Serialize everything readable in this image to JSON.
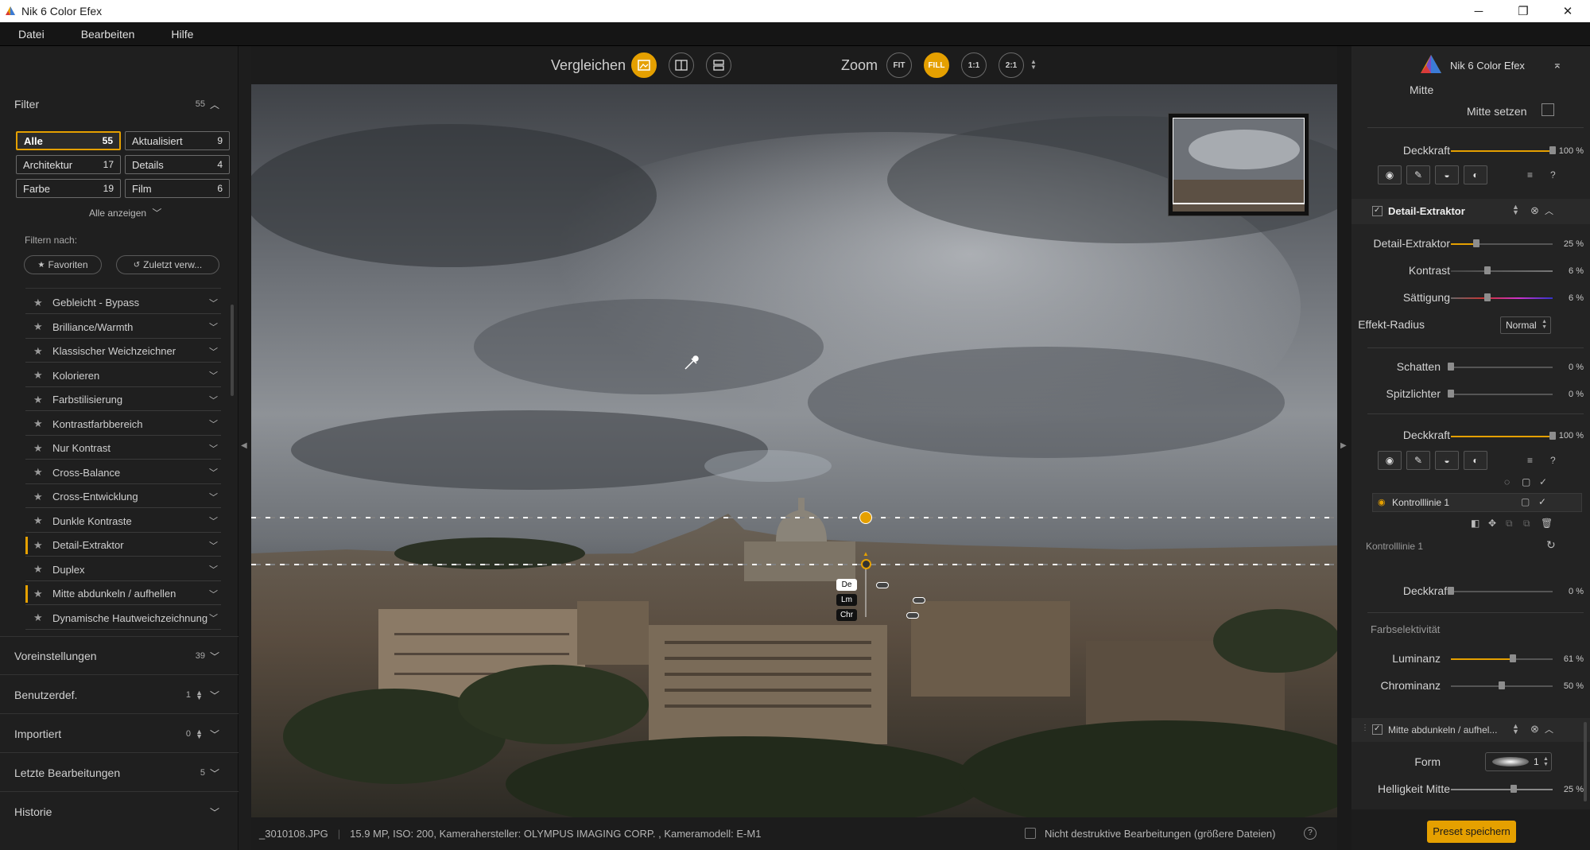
{
  "window": {
    "title": "Nik 6 Color Efex",
    "minimize": "─",
    "maximize": "❐",
    "close": "✕"
  },
  "menu": [
    "Datei",
    "Bearbeiten",
    "Hilfe"
  ],
  "left": {
    "filter_title": "Filter",
    "filter_count": "55",
    "chips": [
      {
        "label": "Alle",
        "count": "55"
      },
      {
        "label": "Aktualisiert",
        "count": "9"
      },
      {
        "label": "Architektur",
        "count": "17"
      },
      {
        "label": "Details",
        "count": "4"
      },
      {
        "label": "Farbe",
        "count": "19"
      },
      {
        "label": "Film",
        "count": "6"
      }
    ],
    "show_all": "Alle anzeigen",
    "filter_by": "Filtern nach:",
    "favorites": "Favoriten",
    "recent": "Zuletzt verw...",
    "filters": [
      "Gebleicht - Bypass",
      "Brilliance/Warmth",
      "Klassischer Weichzeichner",
      "Kolorieren",
      "Farbstilisierung",
      "Kontrastfarbbereich",
      "Nur Kontrast",
      "Cross-Balance",
      "Cross-Entwicklung",
      "Dunkle Kontraste",
      "Detail-Extraktor",
      "Duplex",
      "Mitte abdunkeln / aufhellen",
      "Dynamische Hautweichzeichnung"
    ],
    "sections": [
      {
        "label": "Voreinstellungen",
        "count": "39"
      },
      {
        "label": "Benutzerdef.",
        "count": "1"
      },
      {
        "label": "Importiert",
        "count": "0"
      },
      {
        "label": "Letzte Bearbeitungen",
        "count": "5"
      },
      {
        "label": "Historie",
        "count": ""
      }
    ]
  },
  "toolbar": {
    "compare": "Vergleichen",
    "zoom": "Zoom",
    "fit": "FIT",
    "fill": "FILL",
    "z11": "1:1",
    "z21": "2:1"
  },
  "canvas": {
    "markers": [
      "De",
      "Lm",
      "Chr"
    ]
  },
  "status": {
    "filename": "_3010108.JPG",
    "meta": "15.9 MP, ISO: 200, Kamerahersteller: OLYMPUS IMAGING CORP.  , Kameramodell: E-M1",
    "nondestructive": "Nicht destruktive Bearbeitungen (größere Dateien)"
  },
  "right": {
    "brand": "Nik 6 Color Efex",
    "mitte": "Mitte",
    "mitte_setzen": "Mitte setzen",
    "opacity1": {
      "label": "Deckkraft",
      "value": "100 %",
      "level": 1.0
    },
    "detail_title": "Detail-Extraktor",
    "detail_sliders": [
      {
        "label": "Detail-Extraktor",
        "value": "25 %",
        "level": 0.25
      },
      {
        "label": "Kontrast",
        "value": "6 %",
        "level": 0.36
      },
      {
        "label": "Sättigung",
        "value": "6 %",
        "level": 0.36
      }
    ],
    "effekt_radius": "Effekt-Radius",
    "effekt_radius_value": "Normal",
    "shadow_sliders": [
      {
        "label": "Schatten",
        "value": "0 %",
        "level": 0
      },
      {
        "label": "Spitzlichter",
        "value": "0 %",
        "level": 0
      }
    ],
    "opacity2": {
      "label": "Deckkraft",
      "value": "100 %",
      "level": 1.0
    },
    "controlline_item": "Kontrolllinie 1",
    "controlline_section": "Kontrolllinie 1",
    "opacity3": {
      "label": "Deckkraft",
      "value": "0 %",
      "level": 0
    },
    "farbselektivitaet": "Farbselektivität",
    "color_sliders": [
      {
        "label": "Luminanz",
        "value": "61 %",
        "level": 0.61
      },
      {
        "label": "Chrominanz",
        "value": "50 %",
        "level": 0.5
      }
    ],
    "mitte_title": "Mitte abdunkeln / aufhel...",
    "form_label": "Form",
    "form_value": "1",
    "helligkeit": {
      "label": "Helligkeit Mitte",
      "value": "25 %",
      "level": 0.62
    },
    "preset_save": "Preset speichern"
  },
  "colors": {
    "accent": "#e5a000",
    "panel": "#232323",
    "bg": "#1d1d1d"
  }
}
